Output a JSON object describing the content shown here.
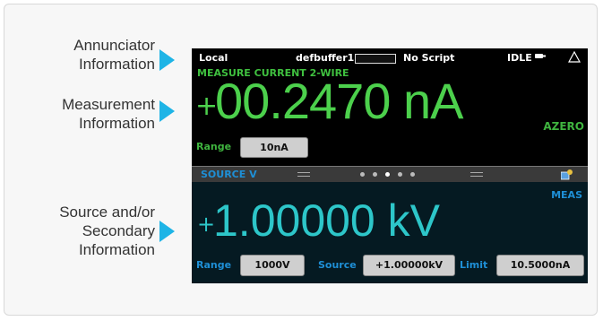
{
  "callouts": {
    "annunciator": [
      "Annunciator",
      "Information"
    ],
    "measurement": [
      "Measurement",
      "Information"
    ],
    "source": [
      "Source and/or",
      "Secondary",
      "Information"
    ]
  },
  "status_bar": {
    "mode": "Local",
    "buffer": "defbuffer1",
    "script": "No Script",
    "state": "IDLE",
    "warning_icon": "warning-triangle-icon",
    "state_icon": "trigger-icon"
  },
  "measurement": {
    "title": "MEASURE CURRENT 2-WIRE",
    "sign": "+",
    "value": "00.2470 nA",
    "azero": "AZERO",
    "range_label": "Range",
    "range_value": "10nA"
  },
  "swipe": {
    "title": "SOURCE V",
    "page_count": 5,
    "active_page": 2,
    "icon": "settings-swipe-icon"
  },
  "source": {
    "meas_label": "MEAS",
    "sign": "+",
    "value": "1.00000 kV",
    "range_label": "Range",
    "range_value": "1000V",
    "source_label": "Source",
    "source_value": "+1.00000kV",
    "limit_label": "Limit",
    "limit_value": "10.5000nA"
  },
  "colors": {
    "arrow": "#1eb4e6",
    "measure_green": "#4cd04c",
    "source_cyan": "#2dc6c9",
    "label_blue": "#1e8fd6"
  }
}
